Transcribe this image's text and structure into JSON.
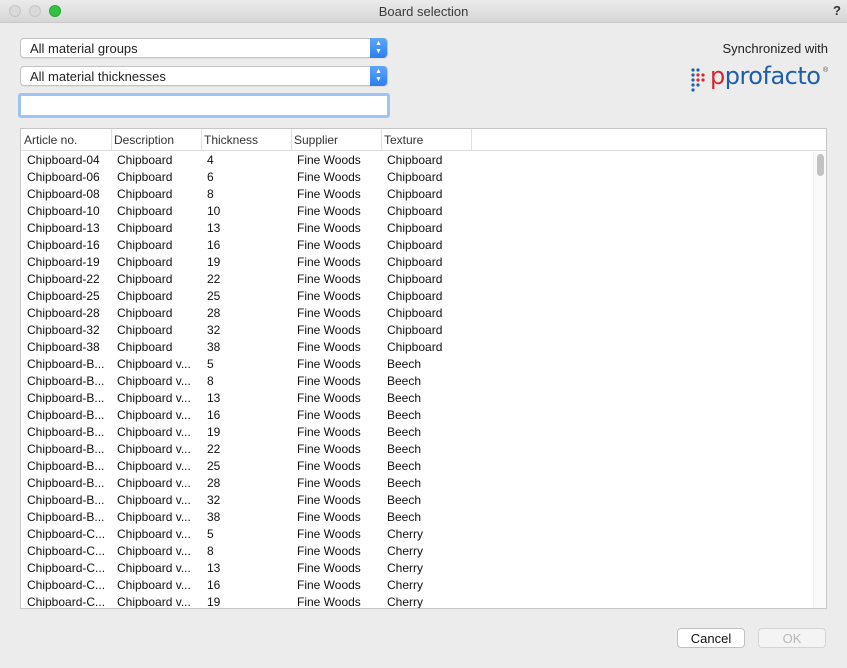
{
  "window": {
    "title": "Board selection",
    "help": "?"
  },
  "filters": {
    "material_group": "All material groups",
    "material_thickness": "All material thicknesses",
    "search_value": ""
  },
  "sync": {
    "text": "Synchronized with",
    "logo_text": "profacto",
    "logo_registered": "®"
  },
  "table": {
    "columns": [
      "Article no.",
      "Description",
      "Thickness",
      "Supplier",
      "Texture"
    ],
    "rows": [
      [
        "Chipboard-04",
        "Chipboard",
        "4",
        "Fine Woods",
        "Chipboard"
      ],
      [
        "Chipboard-06",
        "Chipboard",
        "6",
        "Fine Woods",
        "Chipboard"
      ],
      [
        "Chipboard-08",
        "Chipboard",
        "8",
        "Fine Woods",
        "Chipboard"
      ],
      [
        "Chipboard-10",
        "Chipboard",
        "10",
        "Fine Woods",
        "Chipboard"
      ],
      [
        "Chipboard-13",
        "Chipboard",
        "13",
        "Fine Woods",
        "Chipboard"
      ],
      [
        "Chipboard-16",
        "Chipboard",
        "16",
        "Fine Woods",
        "Chipboard"
      ],
      [
        "Chipboard-19",
        "Chipboard",
        "19",
        "Fine Woods",
        "Chipboard"
      ],
      [
        "Chipboard-22",
        "Chipboard",
        "22",
        "Fine Woods",
        "Chipboard"
      ],
      [
        "Chipboard-25",
        "Chipboard",
        "25",
        "Fine Woods",
        "Chipboard"
      ],
      [
        "Chipboard-28",
        "Chipboard",
        "28",
        "Fine Woods",
        "Chipboard"
      ],
      [
        "Chipboard-32",
        "Chipboard",
        "32",
        "Fine Woods",
        "Chipboard"
      ],
      [
        "Chipboard-38",
        "Chipboard",
        "38",
        "Fine Woods",
        "Chipboard"
      ],
      [
        "Chipboard-B...",
        "Chipboard v...",
        "5",
        "Fine Woods",
        "Beech"
      ],
      [
        "Chipboard-B...",
        "Chipboard v...",
        "8",
        "Fine Woods",
        "Beech"
      ],
      [
        "Chipboard-B...",
        "Chipboard v...",
        "13",
        "Fine Woods",
        "Beech"
      ],
      [
        "Chipboard-B...",
        "Chipboard v...",
        "16",
        "Fine Woods",
        "Beech"
      ],
      [
        "Chipboard-B...",
        "Chipboard v...",
        "19",
        "Fine Woods",
        "Beech"
      ],
      [
        "Chipboard-B...",
        "Chipboard v...",
        "22",
        "Fine Woods",
        "Beech"
      ],
      [
        "Chipboard-B...",
        "Chipboard v...",
        "25",
        "Fine Woods",
        "Beech"
      ],
      [
        "Chipboard-B...",
        "Chipboard v...",
        "28",
        "Fine Woods",
        "Beech"
      ],
      [
        "Chipboard-B...",
        "Chipboard v...",
        "32",
        "Fine Woods",
        "Beech"
      ],
      [
        "Chipboard-B...",
        "Chipboard v...",
        "38",
        "Fine Woods",
        "Beech"
      ],
      [
        "Chipboard-C...",
        "Chipboard v...",
        "5",
        "Fine Woods",
        "Cherry"
      ],
      [
        "Chipboard-C...",
        "Chipboard v...",
        "8",
        "Fine Woods",
        "Cherry"
      ],
      [
        "Chipboard-C...",
        "Chipboard v...",
        "13",
        "Fine Woods",
        "Cherry"
      ],
      [
        "Chipboard-C...",
        "Chipboard v...",
        "16",
        "Fine Woods",
        "Cherry"
      ],
      [
        "Chipboard-C...",
        "Chipboard v...",
        "19",
        "Fine Woods",
        "Cherry"
      ]
    ]
  },
  "buttons": {
    "cancel": "Cancel",
    "ok": "OK"
  },
  "colors": {
    "accent": "#2a7ef2",
    "logo_blue": "#1f5fa8",
    "logo_red": "#d8262e",
    "maximize_green": "#2fc440"
  }
}
